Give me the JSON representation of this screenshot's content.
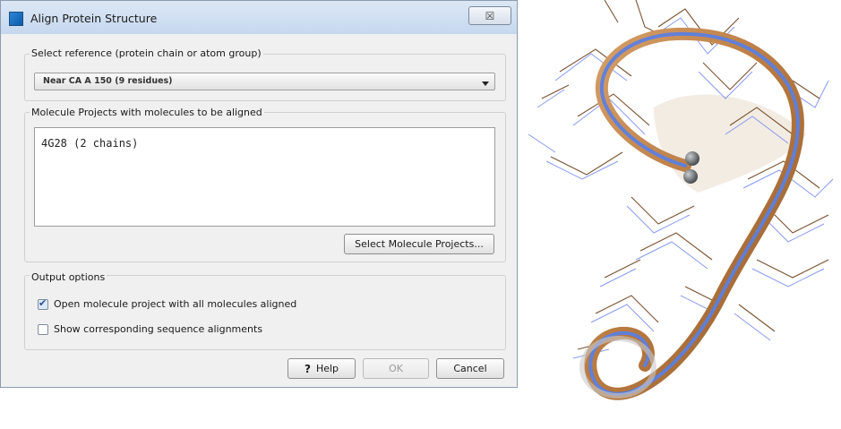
{
  "dialog": {
    "title": "Align Protein Structure",
    "close_label": "☒",
    "reference_group": {
      "label": "Select reference (protein chain or atom group)",
      "selected_value": "Near CA A 150 (9 residues)"
    },
    "molecules_group": {
      "label": "Molecule Projects with molecules to be aligned",
      "items": [
        "4G28 (2 chains)"
      ],
      "select_button": "Select Molecule Projects..."
    },
    "output_group": {
      "label": "Output options",
      "options": [
        {
          "label": "Open molecule project with all molecules aligned",
          "checked": true
        },
        {
          "label": "Show corresponding sequence alignments",
          "checked": false
        }
      ]
    },
    "buttons": {
      "help": "Help",
      "help_icon": "?",
      "ok": "OK",
      "cancel": "Cancel"
    }
  },
  "colors": {
    "ribbon_brown": "#b8793f",
    "ribbon_blue": "#5b7fe0",
    "stick_brown": "#7a5230",
    "stick_blue": "#7c8ff0",
    "atom_gray": "#5f6468"
  }
}
